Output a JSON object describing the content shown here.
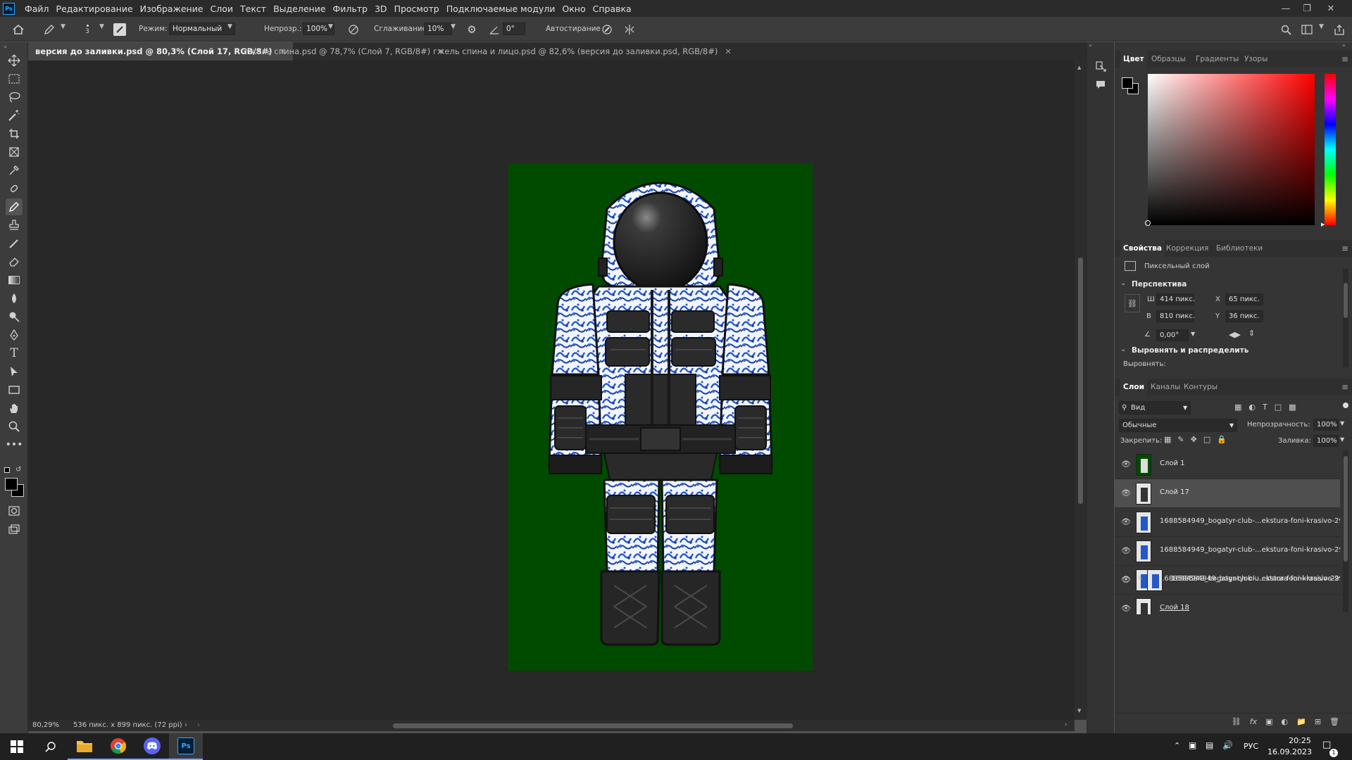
{
  "app": {
    "logo": "Ps"
  },
  "menu": [
    "Файл",
    "Редактирование",
    "Изображение",
    "Слои",
    "Текст",
    "Выделение",
    "Фильтр",
    "3D",
    "Просмотр",
    "Подключаемые модули",
    "Окно",
    "Справка"
  ],
  "options": {
    "brush_size": "3",
    "mode_label": "Режим:",
    "mode_value": "Нормальный",
    "opacity_label": "Непрозр.:",
    "opacity_value": "100%",
    "smoothing_label": "Сглаживание:",
    "smoothing_value": "10%",
    "angle_value": "0°",
    "autoerase_label": "Автостирание"
  },
  "tabs": [
    {
      "label": "версия до заливки.psd @ 80,3% (Слой 17, RGB/8#)",
      "active": true
    },
    {
      "label": "гжель спина.psd @ 78,7% (Слой 7, RGB/8#)",
      "active": false
    },
    {
      "label": "гжель спина и лицо.psd @ 82,6% (версия до заливки.psd, RGB/8#)",
      "active": false
    }
  ],
  "status": {
    "zoom": "80,29%",
    "doc_size": "536 пикс. x 899 пикс. (72 ppi)"
  },
  "color_panel": {
    "tabs": [
      "Цвет",
      "Образцы",
      "Градиенты",
      "Узоры"
    ],
    "active_hue": "#ff0000"
  },
  "properties": {
    "tabs": [
      "Свойства",
      "Коррекция",
      "Библиотеки"
    ],
    "layer_type": "Пиксельный слой",
    "section_transform": "Перспектива",
    "w_label": "Ш",
    "w_value": "414 пикс.",
    "h_label": "В",
    "h_value": "810 пикс.",
    "x_label": "X",
    "x_value": "65 пикс.",
    "y_label": "Y",
    "y_value": "36 пикс.",
    "angle_value": "0,00°",
    "section_align": "Выровнять и распределить",
    "align_label": "Выровнять:"
  },
  "layers_panel": {
    "tabs": [
      "Слои",
      "Каналы",
      "Контуры"
    ],
    "filter_value": "Вид",
    "blend_value": "Обычные",
    "opacity_label": "Непрозрачность:",
    "opacity_value": "100%",
    "lock_label": "Закрепить:",
    "fill_label": "Заливка:",
    "fill_value": "100%",
    "layers": [
      {
        "name": "Слой 1",
        "selected": false
      },
      {
        "name": "Слой 17",
        "selected": true
      },
      {
        "name": "1688584949_bogatyr-club-...ekstura-foni-krasivo-29",
        "selected": false
      },
      {
        "name": "1688584949_bogatyr-club-...ekstura-foni-krasivo-29",
        "selected": false
      },
      {
        "name": "1688584949_bogatyr-club-...ekstura-foni-krasivo-29",
        "selected": false
      },
      {
        "name": "1688584949_bogatyr-clu...stura-foni-krasivo-29",
        "selected": false
      },
      {
        "name": "Слой 18",
        "selected": false
      }
    ]
  },
  "taskbar": {
    "lang": "РУС",
    "time": "20:25",
    "date": "16.09.2023",
    "notifications": "1"
  },
  "colors": {
    "canvas_bg": "#004b00",
    "suit_pattern": "#2458c8",
    "suit_dark": "#2a2a2a"
  }
}
